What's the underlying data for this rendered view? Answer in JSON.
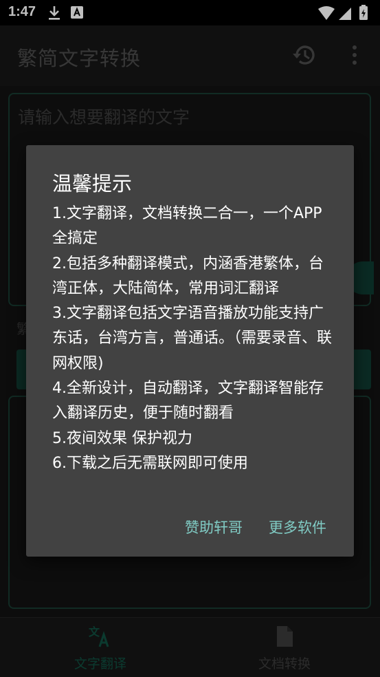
{
  "status_bar": {
    "time": "1:47"
  },
  "app_bar": {
    "title": "繁简文字转换"
  },
  "input": {
    "placeholder": "请输入想要翻译的文字"
  },
  "section_label": "繁",
  "bottom_nav": [
    {
      "label": "文字翻译",
      "active": true
    },
    {
      "label": "文档转换",
      "active": false
    }
  ],
  "dialog": {
    "title": "温馨提示",
    "lines": [
      "1.文字翻译，文档转换二合一，一个APP全搞定",
      "2.包括多种翻译模式，内涵香港繁体，台湾正体，大陆简体，常用词汇翻译",
      "3.文字翻译包括文字语音播放功能支持广东话，台湾方言，普通话。（需要录音、联网权限)",
      "4.全新设计，自动翻译，文字翻译智能存入翻译历史，便于随时翻看",
      "5.夜间效果 保护视力",
      "6.下载之后无需联网即可使用"
    ],
    "buttons": {
      "sponsor": "赞助轩哥",
      "more_apps": "更多软件"
    }
  },
  "colors": {
    "accent": "#80cbc4",
    "dialog_bg": "#424242",
    "dim_green": "#0f4e3f"
  }
}
